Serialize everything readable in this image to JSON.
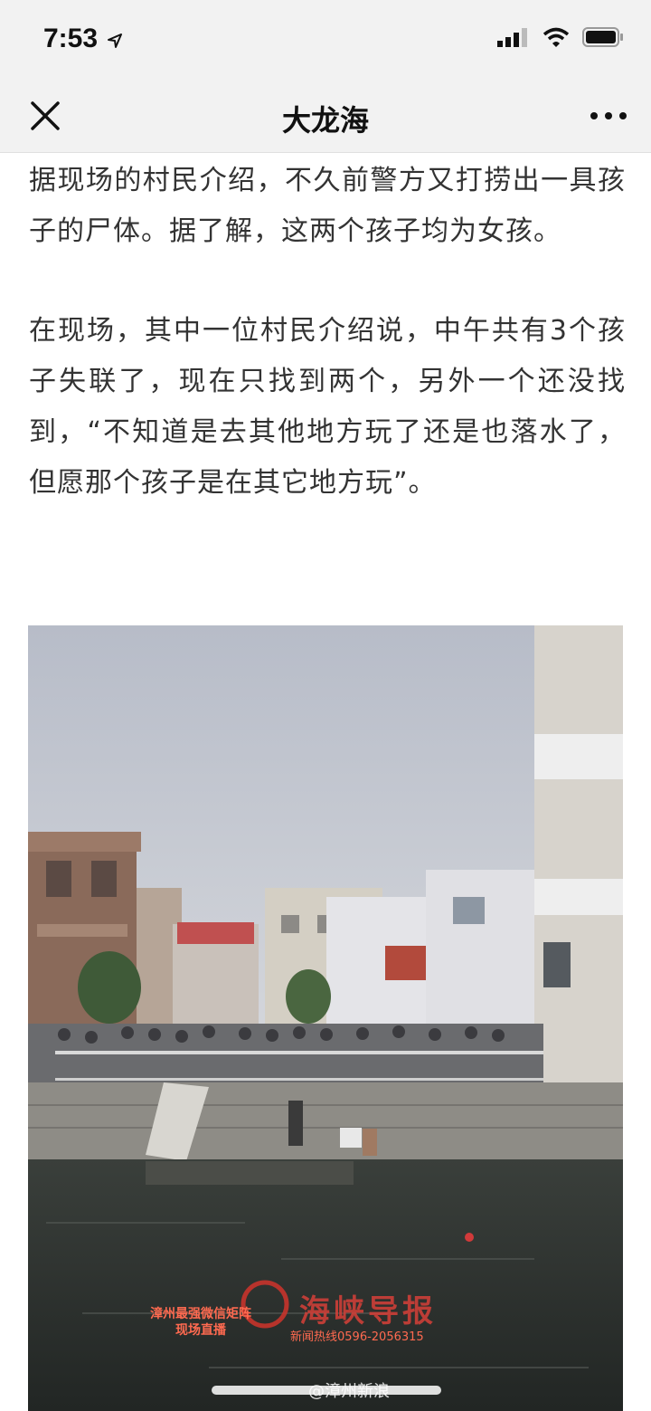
{
  "status_bar": {
    "time": "7:53",
    "location_icon": "location-arrow-icon",
    "signal_icon": "cellular-signal-icon",
    "wifi_icon": "wifi-icon",
    "battery_icon": "battery-icon"
  },
  "nav": {
    "title": "大龙海",
    "close_icon": "close-icon",
    "more_icon": "more-dots-icon"
  },
  "article": {
    "paragraphs": [
      "据现场的村民介绍，不久前警方又打捞出一具孩子的尸体。据了解，这两个孩子均为女孩。",
      "在现场，其中一位村民介绍说，中午共有3个孩子失联了，现在只找到两个，另外一个还没找到，“不知道是去其他地方玩了还是也落水了，但愿那个孩子是在其它地方玩”。"
    ]
  },
  "photo": {
    "watermark_left_line1": "漳州最强微信矩阵",
    "watermark_left_line2": "现场直播",
    "watermark_brand": "海峡导报",
    "watermark_hotline": "新闻热线0596-2056315",
    "caption": "@漳州新浪"
  },
  "colors": {
    "bar_bg": "#f2f2f2",
    "text": "#333333",
    "sky": "#c9ccd4",
    "water": "#2f3430"
  }
}
